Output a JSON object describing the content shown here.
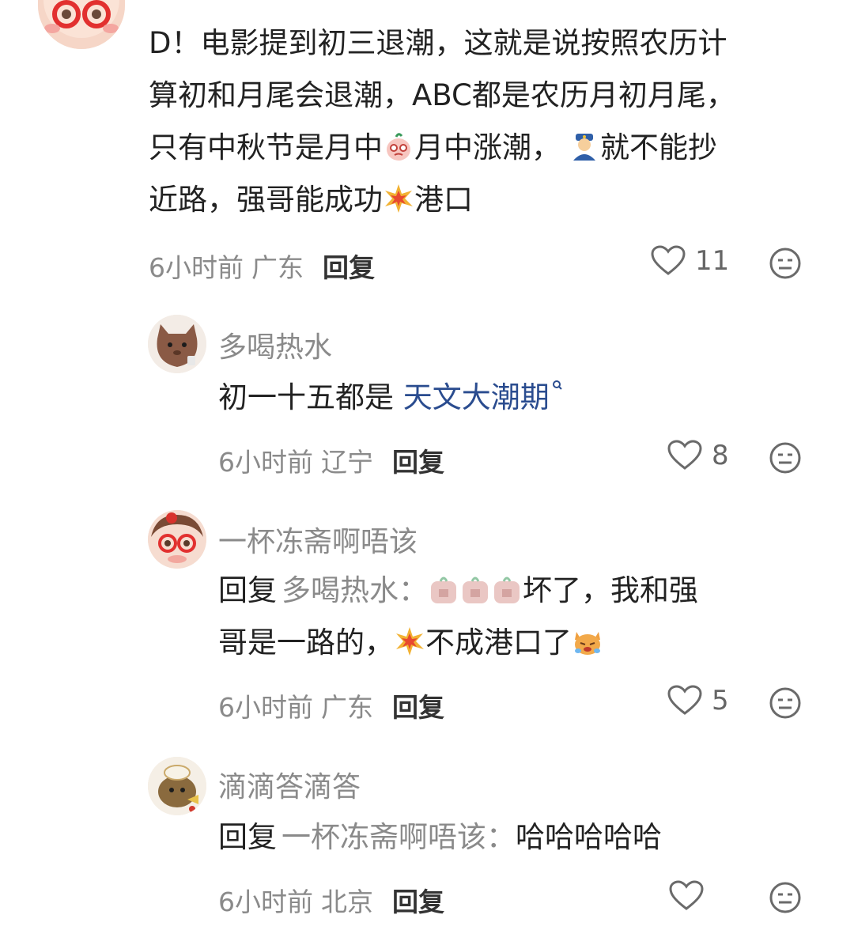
{
  "comments": [
    {
      "id": "c1",
      "username": "",
      "lines": [
        "D！电影提到初三退潮，这就是说按照农历计",
        "算初和月尾会退潮，ABC都是农历月初月尾，",
        "只有中秋节是月中",
        "月中涨潮，",
        "就不能抄",
        "近路，强哥能成功",
        "港口"
      ],
      "time": "6小时前",
      "location": "广东",
      "reply_label": "回复",
      "likes": "11"
    },
    {
      "id": "c2",
      "username": "多喝热水",
      "text_prefix": "初一十五都是",
      "link_text": "天文大潮期",
      "time": "6小时前",
      "location": "辽宁",
      "reply_label": "回复",
      "likes": "8"
    },
    {
      "id": "c3",
      "username": "一杯冻斋啊唔该",
      "reply_prefix": "回复",
      "reply_to": "多喝热水：",
      "line1_tail": "坏了，我和强",
      "line2_a": "哥是一路的，",
      "line2_b": "不成港口了",
      "time": "6小时前",
      "location": "广东",
      "reply_label": "回复",
      "likes": "5"
    },
    {
      "id": "c4",
      "username": "滴滴答滴答",
      "reply_prefix": "回复",
      "reply_to": "一杯冻斋啊唔该：",
      "text": "哈哈哈哈哈",
      "time": "6小时前",
      "location": "北京",
      "reply_label": "回复",
      "likes": ""
    }
  ],
  "icons": {
    "like": "heart-outline-icon",
    "reaction": "meh-face-icon"
  },
  "colors": {
    "link": "#2a4c8f",
    "muted": "#8a8a8a",
    "text": "#222222"
  }
}
